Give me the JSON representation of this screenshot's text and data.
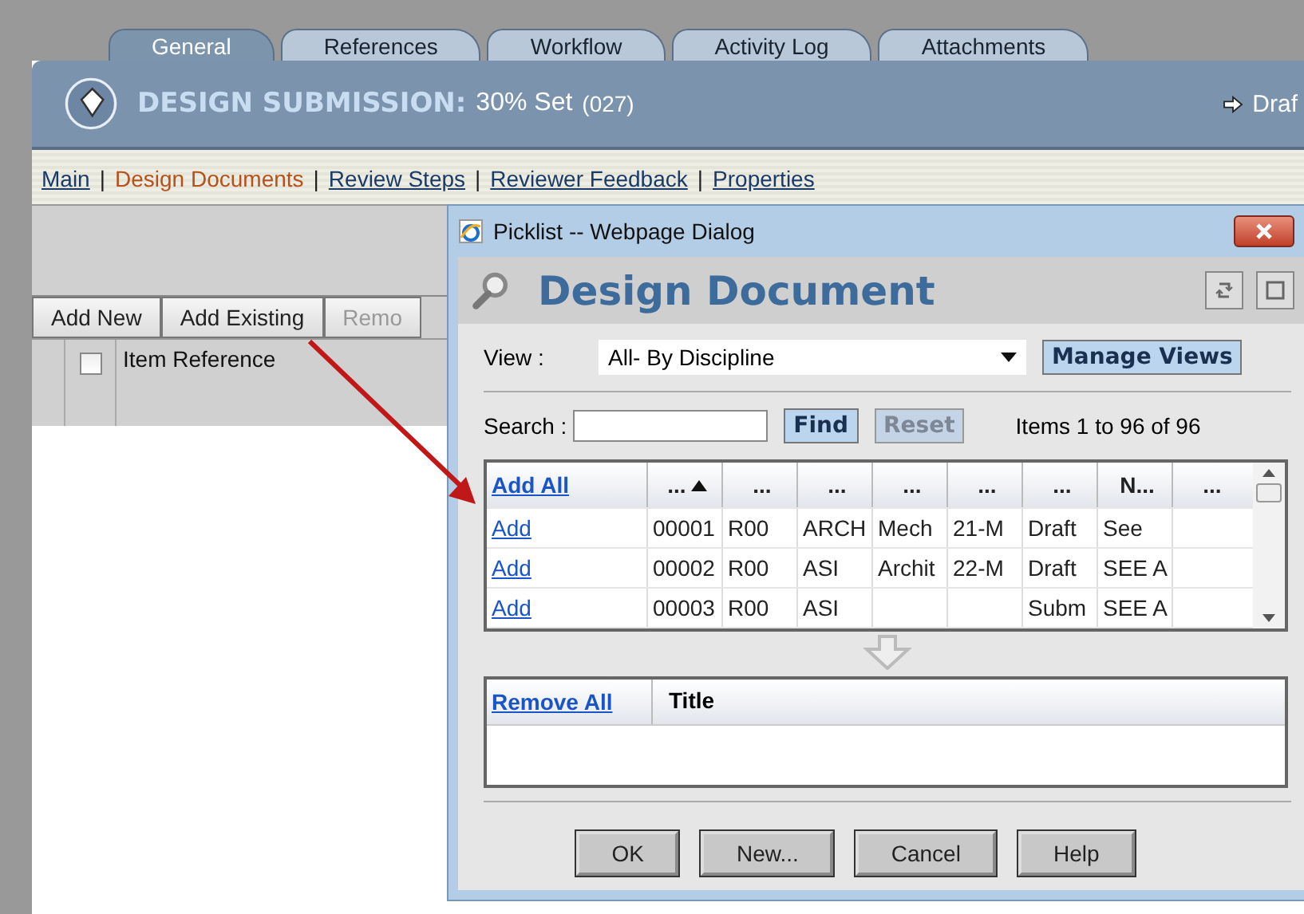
{
  "tabs": [
    {
      "label": "General",
      "selected": true
    },
    {
      "label": "References",
      "selected": false
    },
    {
      "label": "Workflow",
      "selected": false
    },
    {
      "label": "Activity Log",
      "selected": false
    },
    {
      "label": "Attachments",
      "selected": false
    }
  ],
  "header": {
    "title": "DESIGN SUBMISSION:",
    "subtitle": "30% Set",
    "code": "(027)",
    "status": "Draf"
  },
  "subnav": [
    {
      "label": "Main",
      "selected": false
    },
    {
      "separator": "|",
      "label": "Design Documents",
      "selected": true
    },
    {
      "separator": "|",
      "label": "Review Steps",
      "selected": false
    },
    {
      "separator": "|",
      "label": "Reviewer Feedback",
      "selected": false
    },
    {
      "separator": "|",
      "label": "Properties",
      "selected": false
    }
  ],
  "toolbar": [
    {
      "label": "Add New",
      "disabled": false
    },
    {
      "label": "Add Existing",
      "disabled": false
    },
    {
      "label": "Remo",
      "disabled": true
    }
  ],
  "list": {
    "select_all_checked": false,
    "column": "Item Reference"
  },
  "dialog": {
    "title": "Picklist -- Webpage Dialog",
    "heading": "Design Document",
    "view": {
      "label": "View :",
      "value": "All- By Discipline",
      "button": "Manage Views"
    },
    "search": {
      "label": "Search :",
      "find": "Find",
      "reset": "Reset",
      "reset_disabled": true,
      "count": "Items 1 to 96 of 96"
    },
    "available": {
      "add_all": "Add All",
      "columns": [
        {
          "label": "...",
          "sorted": true
        },
        {
          "label": "...",
          "sorted": false
        },
        {
          "label": "...",
          "sorted": false
        },
        {
          "label": "...",
          "sorted": false
        },
        {
          "label": "...",
          "sorted": false
        },
        {
          "label": "...",
          "sorted": false
        },
        {
          "label": "N...",
          "sorted": false
        },
        {
          "label": "...",
          "sorted": false
        }
      ],
      "rows": [
        {
          "action": "Add",
          "cells": [
            "00001",
            "R00",
            "ARCH",
            "Mech",
            "21-M",
            "Draft",
            "See",
            ""
          ]
        },
        {
          "action": "Add",
          "cells": [
            "00002",
            "R00",
            "ASI",
            "Archit",
            "22-M",
            "Draft",
            "SEE A",
            ""
          ]
        },
        {
          "action": "Add",
          "cells": [
            "00003",
            "R00",
            "ASI",
            "",
            "",
            "Subm",
            "SEE A",
            ""
          ]
        }
      ]
    },
    "selected": {
      "remove_all": "Remove All",
      "columns": [
        "Title"
      ]
    },
    "buttons": [
      "OK",
      "New...",
      "Cancel",
      "Help"
    ]
  }
}
